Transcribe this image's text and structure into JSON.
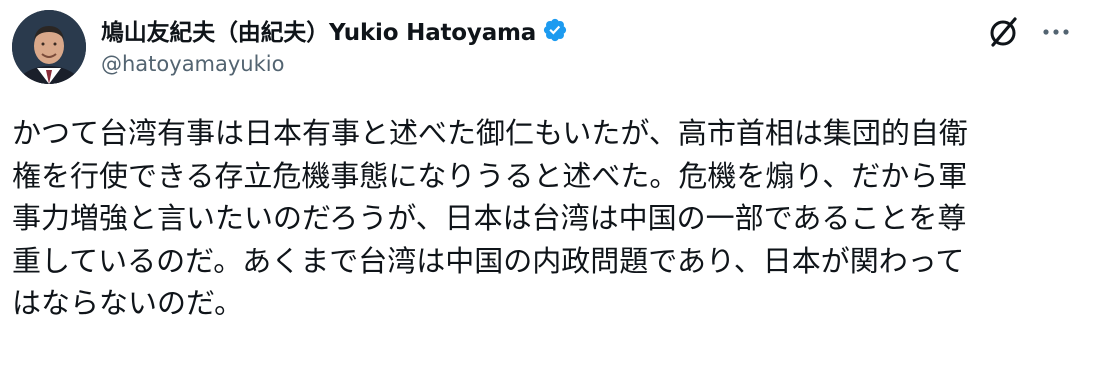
{
  "author": {
    "display_name": "鳩山友紀夫（由紀夫）Yukio Hatoyama",
    "handle": "@hatoyamayukio",
    "verified": true,
    "verified_color": "#1d9bf0"
  },
  "icons": {
    "avatar": "avatar",
    "verified": "verified-badge-icon",
    "grok": "grok-icon",
    "more": "more-dots-icon"
  },
  "tweet": {
    "text": "かつて台湾有事は日本有事と述べた御仁もいたが、高市首相は集団的自衛\n権を行使できる存立危機事態になりうると述べた。危機を煽り、だから軍\n事力増強と言いたいのだろうが、日本は台湾は中国の一部であることを尊\n重しているのだ。あくまで台湾は中国の内政問題であり、日本が関わって\nはならないのだ。"
  }
}
